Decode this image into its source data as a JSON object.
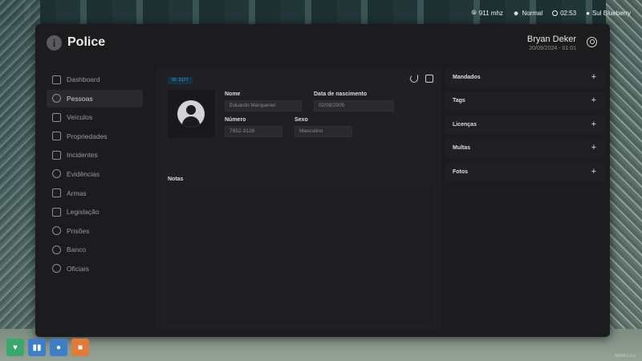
{
  "hud": {
    "radio": "911 mhz",
    "status": "Normal",
    "time": "02:53",
    "location": "Sul Blueberry"
  },
  "app": {
    "title": "Police",
    "user_name": "Bryan Deker",
    "user_date": "20/09/2024 - 01:01"
  },
  "sidebar": {
    "items": [
      {
        "label": "Dashboard",
        "icon": "home-icon"
      },
      {
        "label": "Pessoas",
        "icon": "user-circle-icon"
      },
      {
        "label": "Veículos",
        "icon": "car-icon"
      },
      {
        "label": "Propriedades",
        "icon": "house-icon"
      },
      {
        "label": "Incidentes",
        "icon": "warning-icon"
      },
      {
        "label": "Evidências",
        "icon": "search-icon"
      },
      {
        "label": "Armas",
        "icon": "gun-icon"
      },
      {
        "label": "Legislação",
        "icon": "scale-icon"
      },
      {
        "label": "Prisões",
        "icon": "handcuffs-icon"
      },
      {
        "label": "Banco",
        "icon": "money-icon"
      },
      {
        "label": "Oficiais",
        "icon": "officers-icon"
      }
    ],
    "active": "Pessoas"
  },
  "profile": {
    "id_badge": "ID: 3177",
    "name_label": "Nome",
    "name_value": "Eduardo Marquenel",
    "dob_label": "Data de nascimento",
    "dob_value": "02/08/2005",
    "phone_label": "Número",
    "phone_value": "7852-3128",
    "sex_label": "Sexo",
    "sex_value": "Masculino",
    "notes_label": "Notas"
  },
  "right_panel": {
    "sections": [
      "Mandados",
      "Tags",
      "Licenças",
      "Multas",
      "Fotos"
    ]
  },
  "status_colors": [
    "#3aa86b",
    "#3d7fc6",
    "#3d7fc6",
    "#e07b3a"
  ],
  "watermark": "NOVA 1.0.0"
}
